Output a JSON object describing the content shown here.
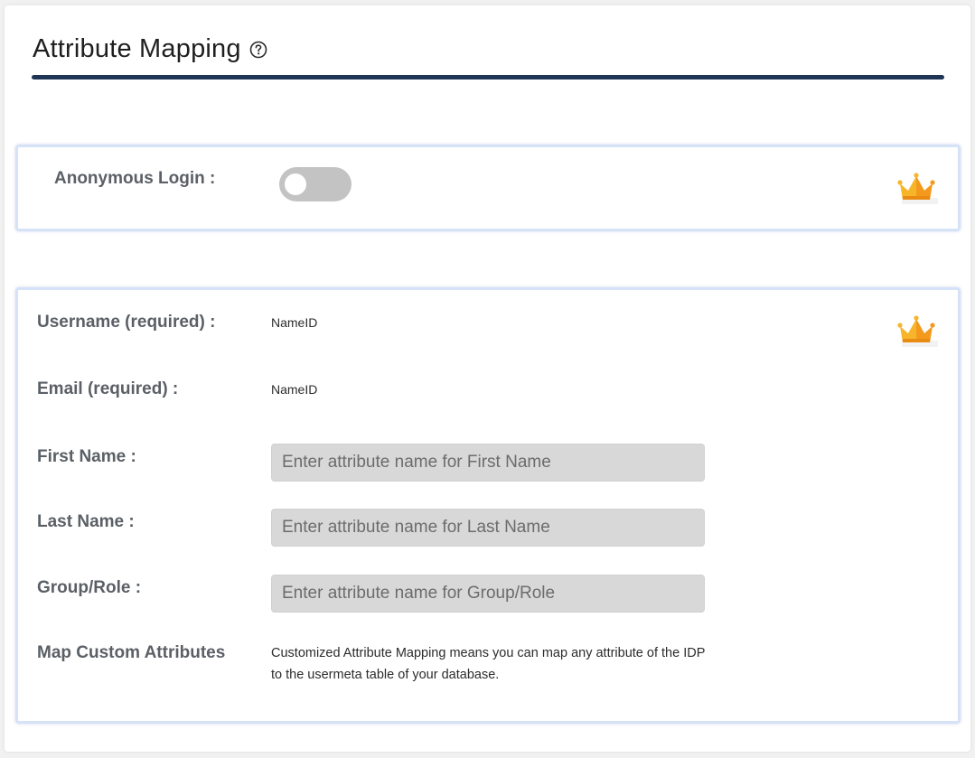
{
  "header": {
    "title": "Attribute Mapping",
    "help_icon": "question-circle-icon"
  },
  "anonymous": {
    "label": "Anonymous Login :",
    "toggle_on": false,
    "premium_icon": "crown-icon"
  },
  "mapping": {
    "premium_icon": "crown-icon",
    "username": {
      "label": "Username (required) :",
      "value": "NameID"
    },
    "email": {
      "label": "Email (required) :",
      "value": "NameID"
    },
    "first_name": {
      "label": "First Name :",
      "placeholder": "Enter attribute name for First Name",
      "value": ""
    },
    "last_name": {
      "label": "Last Name :",
      "placeholder": "Enter attribute name for Last Name",
      "value": ""
    },
    "group_role": {
      "label": "Group/Role :",
      "placeholder": "Enter attribute name for Group/Role",
      "value": ""
    },
    "custom": {
      "label": "Map Custom Attributes",
      "description": "Customized Attribute Mapping means you can map any attribute of the IDP to the usermeta table of your database."
    }
  },
  "colors": {
    "underline": "#1f3556",
    "card_border": "#d6e2f7",
    "toggle_off": "#c3c3c3",
    "crown": "#f7b52b"
  }
}
